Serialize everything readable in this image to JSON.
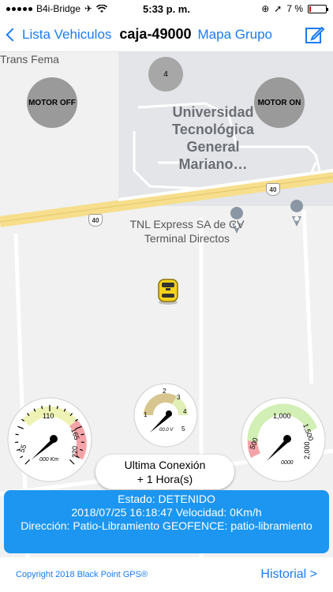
{
  "status_bar": {
    "carrier": "B4i-Bridge",
    "time": "5:33 p. m.",
    "battery": "7 %"
  },
  "nav": {
    "back_label": "Lista Vehiculos",
    "title": "caja-49000",
    "group_label": "Mapa Grupo"
  },
  "map": {
    "cluster_count": "4",
    "motor_off_label": "MOTOR OFF",
    "motor_on_label": "MOTOR ON",
    "poi_university": "Universidad Tecnológica General Mariano…",
    "poi_tnl": "TNL Express SA de CV Terminal Directos",
    "poi_trans": "Trans Fema",
    "highway_number": "40"
  },
  "gauges": {
    "speed": {
      "ticks": [
        "55",
        "110",
        "165",
        "220"
      ],
      "readout": "000 Km",
      "value": 0
    },
    "voltage": {
      "ticks": [
        "1",
        "2",
        "3",
        "4",
        "5"
      ],
      "readout": "00.0 V",
      "value": 0
    },
    "rpm": {
      "ticks": [
        "500",
        "1,000",
        "1,500",
        "2,000"
      ],
      "readout": "0000",
      "value": 0
    }
  },
  "last_connection": {
    "line1": "Ultima Conexión",
    "line2": "+ 1 Hora(s)"
  },
  "status_panel": {
    "estado": "Estado: DETENIDO",
    "fecha_velocidad": "2018/07/25 16:18:47 Velocidad: 0Km/h",
    "direccion": "Dirección: Patio-Libramiento GEOFENCE: patio-libramiento"
  },
  "footer": {
    "copyright": "Copyright 2018 Black Point GPS®",
    "historial_label": "Historial >"
  },
  "colors": {
    "accent": "#1a7cf3",
    "status_panel": "#1c96f0",
    "vehicle": "#f5d21a"
  }
}
